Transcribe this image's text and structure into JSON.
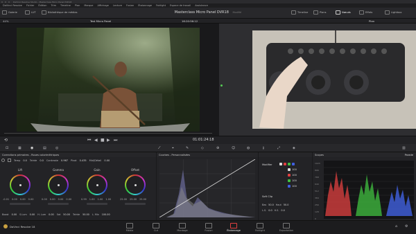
{
  "window": {
    "title": "DaVinci Resolve Studio - Masterclass Micro Panel DVR18"
  },
  "menu": [
    "DaVinci Resolve",
    "Fichier",
    "Édition",
    "Trim",
    "Timeline",
    "Plan",
    "Marque",
    "Affichage",
    "Lecture",
    "Fusion",
    "Étalonnage",
    "Fairlight",
    "Espace de travail",
    "Assistance"
  ],
  "toolbar": {
    "gallery": "Galerie",
    "lut": "LUT",
    "media_library": "Bibliothèque de médias",
    "project_name": "Masterclass Micro Panel DVR18",
    "edit_label": "Modifié",
    "timeline": "Timeline",
    "clips": "Plans",
    "nodes": "Nœuds",
    "effects": "Effets",
    "lightbox": "Lightbox"
  },
  "viewer": {
    "zoom": "44%",
    "clip_name": "Test Micro Panel",
    "timecode": "16:20:56:12",
    "node_mode": "Plan",
    "playhead_timecode": "01:01:24:18"
  },
  "primaries": {
    "title": "Corrections primaires - Roues colorimétriques",
    "temp_label": "Temp",
    "temp": "0.0",
    "tint_label": "Teinte",
    "tint": "0.0",
    "contrast_label": "Contraste",
    "contrast": "0.967",
    "pivot_label": "Pivot",
    "pivot": "0.435",
    "middetail_label": "Mid/Détail",
    "middetail": "0.00",
    "wheels": [
      {
        "name": "Lift",
        "values": [
          "-0.01",
          "0.00",
          "0.00",
          "0.00"
        ],
        "bottom": "0.00"
      },
      {
        "name": "Gamma",
        "values": [
          "0.00",
          "0.00",
          "0.00",
          "0.00"
        ],
        "bottom": "0.00"
      },
      {
        "name": "Gain",
        "values": [
          "0.99",
          "1.00",
          "1.00",
          "1.00"
        ],
        "bottom": "1.00"
      },
      {
        "name": "Offset",
        "values": [
          "25.00",
          "25.00",
          "25.00"
        ],
        "bottom": "25.00"
      }
    ],
    "footer": [
      {
        "label": "Boost",
        "value": "0.00"
      },
      {
        "label": "S.Lum",
        "value": "0.00"
      },
      {
        "label": "H. Lum",
        "value": "0.00"
      },
      {
        "label": "Sat",
        "value": "50.00"
      },
      {
        "label": "Teinte",
        "value": "50.00"
      },
      {
        "label": "L. Mix",
        "value": "100.00"
      }
    ]
  },
  "curves": {
    "title": "Courbes - Personnalisées"
  },
  "modifier": {
    "title": "Modifier",
    "rows": [
      {
        "color": "#dddddd",
        "value": "100"
      },
      {
        "color": "#e04040",
        "value": "100"
      },
      {
        "color": "#40c040",
        "value": "100"
      },
      {
        "color": "#4060e0",
        "value": "100"
      }
    ],
    "softclip_label": "Soft Clip",
    "low_label": "Bas",
    "low": "50.0",
    "high_label": "Haut",
    "high": "50.0",
    "ls_label": "L.S.",
    "ls": "0.0",
    "hs_label": "H.S.",
    "hs": "0.0"
  },
  "scopes": {
    "title": "Scopes",
    "mode": "Parade",
    "ticks": [
      "1023",
      "896",
      "768",
      "640",
      "512",
      "384",
      "256",
      "128",
      "0"
    ]
  },
  "pages": [
    "Média",
    "Cut",
    "Montage",
    "Fusion",
    "Étalonnage",
    "Fairlight",
    "Exportation"
  ],
  "active_page": "Étalonnage",
  "app_name": "DaVinci Resolve 18",
  "colors": {
    "accent": "#e04040",
    "panel": "#232326",
    "background": "#1a1a1c"
  }
}
